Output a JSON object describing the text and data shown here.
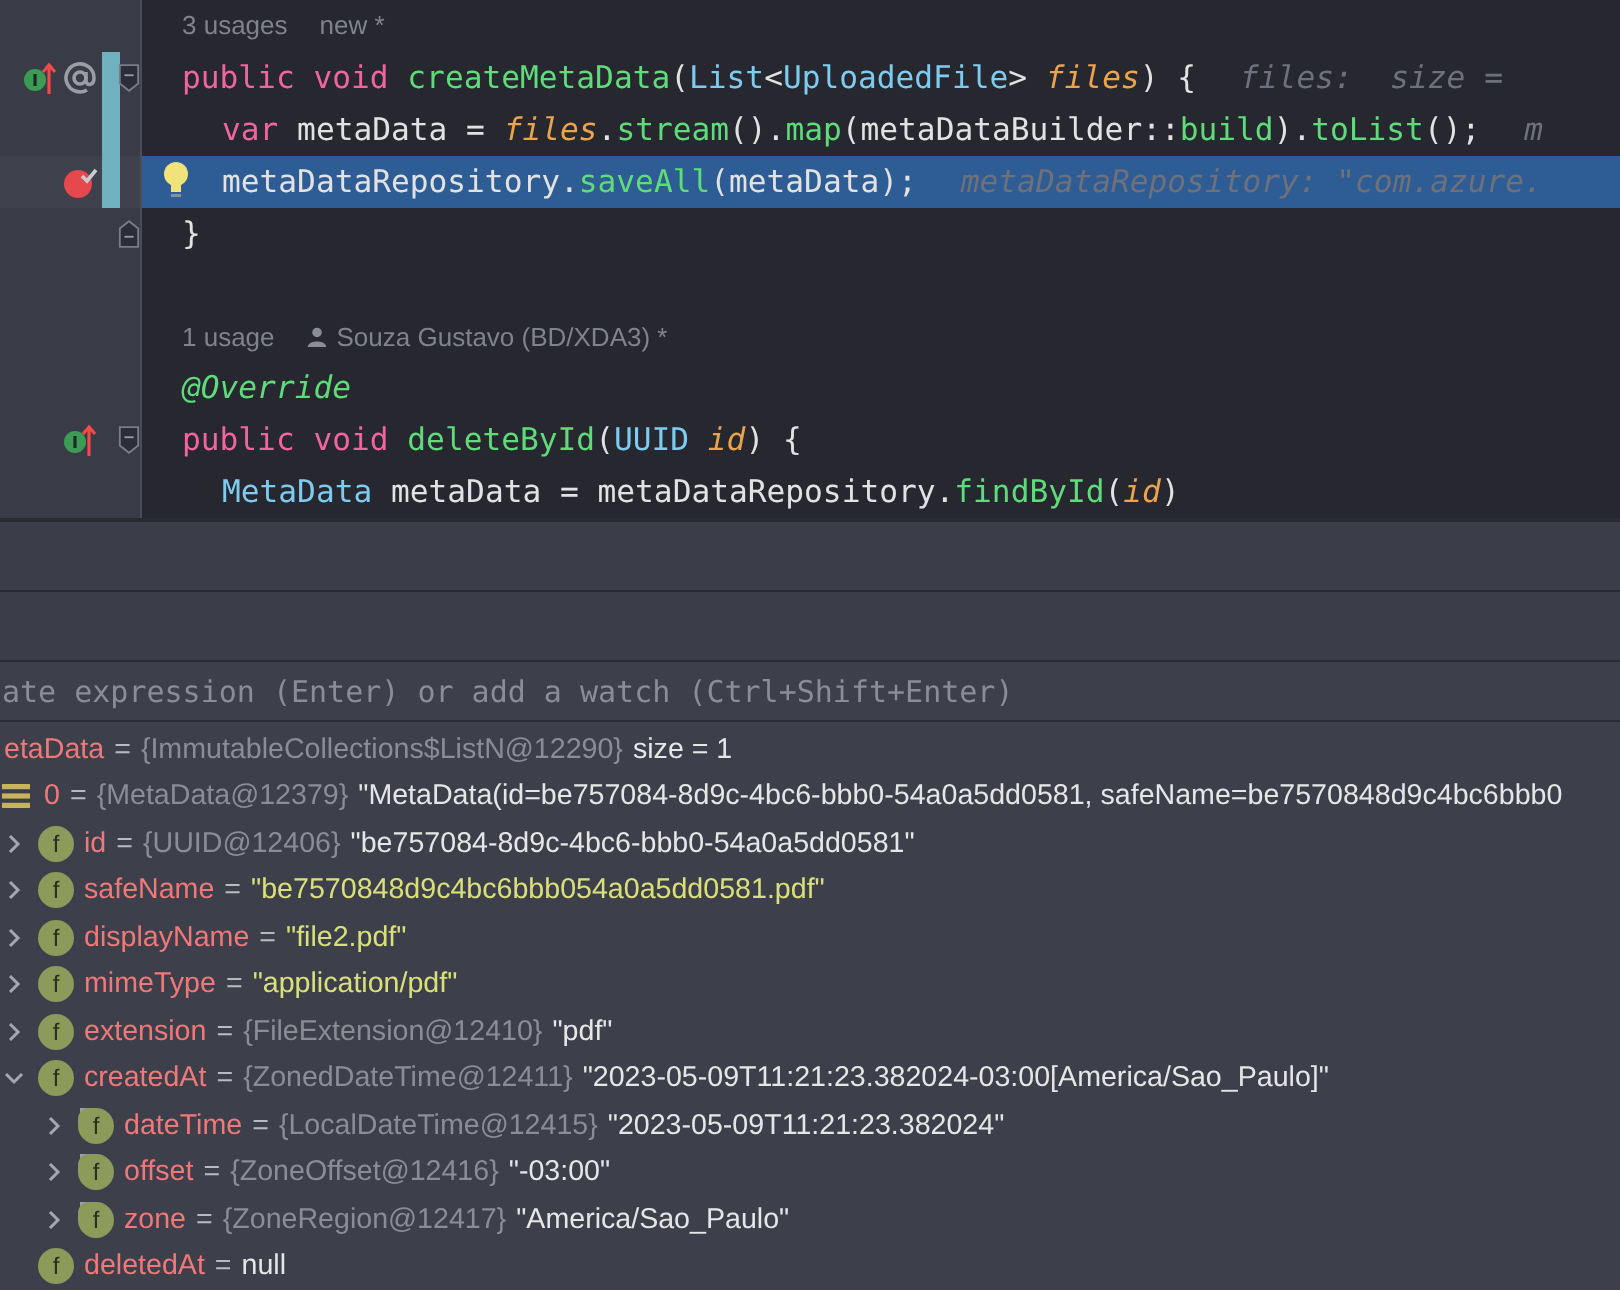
{
  "editor": {
    "lines": [
      {
        "kind": "meta",
        "items": [
          {
            "kind": "plain",
            "text": "3 usages"
          },
          {
            "kind": "plain",
            "text": "new *"
          }
        ]
      },
      {
        "kind": "code",
        "gutter_icons": [
          {
            "kind": "implements"
          },
          {
            "kind": "annotated"
          }
        ],
        "fold": {
          "kind": "start"
        },
        "changed": true,
        "current": false,
        "tokens": [
          {
            "kind": "keyword",
            "text": "public "
          },
          {
            "kind": "keyword",
            "text": "void "
          },
          {
            "kind": "method",
            "text": "createMetaData"
          },
          {
            "kind": "plain",
            "text": "("
          },
          {
            "kind": "type",
            "text": "List"
          },
          {
            "kind": "plain",
            "text": "<"
          },
          {
            "kind": "type",
            "text": "UploadedFile"
          },
          {
            "kind": "plain",
            "text": "> "
          },
          {
            "kind": "param",
            "text": "files"
          },
          {
            "kind": "plain",
            "text": ") {"
          }
        ],
        "hint": "files:  size ="
      },
      {
        "kind": "code",
        "indent": true,
        "changed": true,
        "current": false,
        "tokens": [
          {
            "kind": "keyword",
            "text": "var"
          },
          {
            "kind": "plain",
            "text": " metaData = "
          },
          {
            "kind": "param",
            "text": "files"
          },
          {
            "kind": "plain",
            "text": "."
          },
          {
            "kind": "method",
            "text": "stream"
          },
          {
            "kind": "plain",
            "text": "()."
          },
          {
            "kind": "method",
            "text": "map"
          },
          {
            "kind": "plain",
            "text": "(metaDataBuilder::"
          },
          {
            "kind": "method",
            "text": "build"
          },
          {
            "kind": "plain",
            "text": ")."
          },
          {
            "kind": "method",
            "text": "toList"
          },
          {
            "kind": "plain",
            "text": "();"
          }
        ],
        "hint": "m"
      },
      {
        "kind": "code",
        "indent": true,
        "gutter_icons": [
          {
            "kind": "breakpoint"
          }
        ],
        "bulb": true,
        "changed": true,
        "current": true,
        "tokens": [
          {
            "kind": "plain",
            "text": "metaDataRepository."
          },
          {
            "kind": "method",
            "text": "saveAll"
          },
          {
            "kind": "plain",
            "text": "(metaData);"
          }
        ],
        "hint": "metaDataRepository: \"com.azure."
      },
      {
        "kind": "code",
        "fold": {
          "kind": "end"
        },
        "changed": false,
        "current": false,
        "tokens": [
          {
            "kind": "plain",
            "text": "}"
          }
        ]
      },
      {
        "kind": "blank"
      },
      {
        "kind": "meta",
        "items": [
          {
            "kind": "plain",
            "text": "1 usage"
          },
          {
            "kind": "author",
            "text": "Souza Gustavo (BD/XDA3) *"
          }
        ]
      },
      {
        "kind": "code",
        "changed": false,
        "current": false,
        "tokens": [
          {
            "kind": "annotation",
            "text": "@Override"
          }
        ]
      },
      {
        "kind": "code",
        "gutter_icons": [
          {
            "kind": "implements"
          }
        ],
        "fold": {
          "kind": "start"
        },
        "changed": false,
        "current": false,
        "tokens": [
          {
            "kind": "keyword",
            "text": "public "
          },
          {
            "kind": "keyword",
            "text": "void "
          },
          {
            "kind": "method",
            "text": "deleteById"
          },
          {
            "kind": "plain",
            "text": "("
          },
          {
            "kind": "type",
            "text": "UUID "
          },
          {
            "kind": "param",
            "text": "id"
          },
          {
            "kind": "plain",
            "text": ") {"
          }
        ]
      },
      {
        "kind": "code",
        "indent": true,
        "changed": false,
        "current": false,
        "tokens": [
          {
            "kind": "type",
            "text": "MetaData"
          },
          {
            "kind": "plain",
            "text": " metaData = metaDataRepository."
          },
          {
            "kind": "method",
            "text": "findById"
          },
          {
            "kind": "plain",
            "text": "("
          },
          {
            "kind": "param",
            "text": "id"
          },
          {
            "kind": "plain",
            "text": ")"
          }
        ]
      }
    ]
  },
  "debugger": {
    "expression_field": {
      "placeholder": "ate expression (Enter) or add a watch (Ctrl+Shift+Enter)"
    },
    "variables": [
      {
        "name": "etaData",
        "operator": "=",
        "type": "{ImmutableCollections$ListN@12290}",
        "value": "size = 1",
        "string": false,
        "children": [
          {
            "kind": "list",
            "name": "0",
            "operator": "=",
            "type": "{MetaData@12379}",
            "value": "\"MetaData(id=be757084-8d9c-4bc6-bbb0-54a0a5dd0581, safeName=be7570848d9c4bc6bbb0",
            "string": false,
            "children": [
              {
                "kind": "field",
                "badge": "f",
                "name": "id",
                "operator": "=",
                "type": "{UUID@12406}",
                "value": "\"be757084-8d9c-4bc6-bbb0-54a0a5dd0581\"",
                "string": false,
                "expanded": false
              },
              {
                "kind": "field",
                "badge": "f",
                "name": "safeName",
                "operator": "=",
                "value": "\"be7570848d9c4bc6bbb054a0a5dd0581.pdf\"",
                "string": true,
                "expanded": false
              },
              {
                "kind": "field",
                "badge": "f",
                "name": "displayName",
                "operator": "=",
                "value": "\"file2.pdf\"",
                "string": true,
                "expanded": false
              },
              {
                "kind": "field",
                "badge": "f",
                "name": "mimeType",
                "operator": "=",
                "value": "\"application/pdf\"",
                "string": true,
                "expanded": false
              },
              {
                "kind": "field",
                "badge": "f",
                "name": "extension",
                "operator": "=",
                "type": "{FileExtension@12410}",
                "value": "\"pdf\"",
                "string": false,
                "expanded": false
              },
              {
                "kind": "field",
                "badge": "f",
                "name": "createdAt",
                "operator": "=",
                "type": "{ZonedDateTime@12411}",
                "value": "\"2023-05-09T11:21:23.382024-03:00[America/Sao_Paulo]\"",
                "string": false,
                "expanded": true,
                "children": [
                  {
                    "kind": "final-field",
                    "badge": "f",
                    "name": "dateTime",
                    "operator": "=",
                    "type": "{LocalDateTime@12415}",
                    "value": "\"2023-05-09T11:21:23.382024\"",
                    "string": false,
                    "expanded": false
                  },
                  {
                    "kind": "final-field",
                    "badge": "f",
                    "name": "offset",
                    "operator": "=",
                    "type": "{ZoneOffset@12416}",
                    "value": "\"-03:00\"",
                    "string": false,
                    "expanded": false
                  },
                  {
                    "kind": "final-field",
                    "badge": "f",
                    "name": "zone",
                    "operator": "=",
                    "type": "{ZoneRegion@12417}",
                    "value": "\"America/Sao_Paulo\"",
                    "string": false,
                    "expanded": false
                  }
                ]
              },
              {
                "kind": "field",
                "badge": "f",
                "name": "deletedAt",
                "operator": "=",
                "value": "null",
                "string": false
              }
            ]
          }
        ]
      }
    ]
  }
}
